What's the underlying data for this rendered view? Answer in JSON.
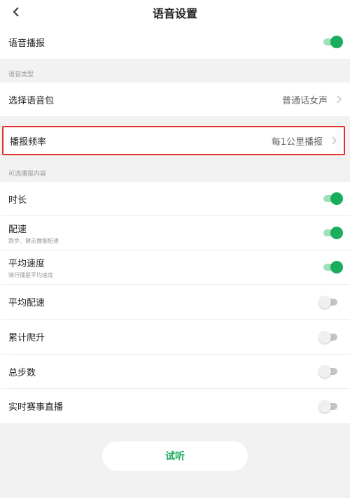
{
  "header": {
    "title": "语音设置"
  },
  "voice_broadcast": {
    "label": "语音播报",
    "enabled": true
  },
  "voice_type_section": {
    "label": "语音类型"
  },
  "voice_pack": {
    "label": "选择语音包",
    "value": "普通话女声"
  },
  "frequency": {
    "label": "播报频率",
    "value": "每1公里播报"
  },
  "content_section": {
    "label": "可选播报内容"
  },
  "content_items": [
    {
      "label": "时长",
      "sublabel": "",
      "enabled": true
    },
    {
      "label": "配速",
      "sublabel": "跑步、健走播报配速",
      "enabled": true
    },
    {
      "label": "平均速度",
      "sublabel": "骑行播报平均速度",
      "enabled": true
    },
    {
      "label": "平均配速",
      "sublabel": "",
      "enabled": false
    },
    {
      "label": "累计爬升",
      "sublabel": "",
      "enabled": false
    },
    {
      "label": "总步数",
      "sublabel": "",
      "enabled": false
    },
    {
      "label": "实时赛事直播",
      "sublabel": "",
      "enabled": false
    }
  ],
  "listen_button": {
    "label": "试听"
  },
  "colors": {
    "accent": "#1aad5c",
    "highlight": "#e3322b"
  }
}
